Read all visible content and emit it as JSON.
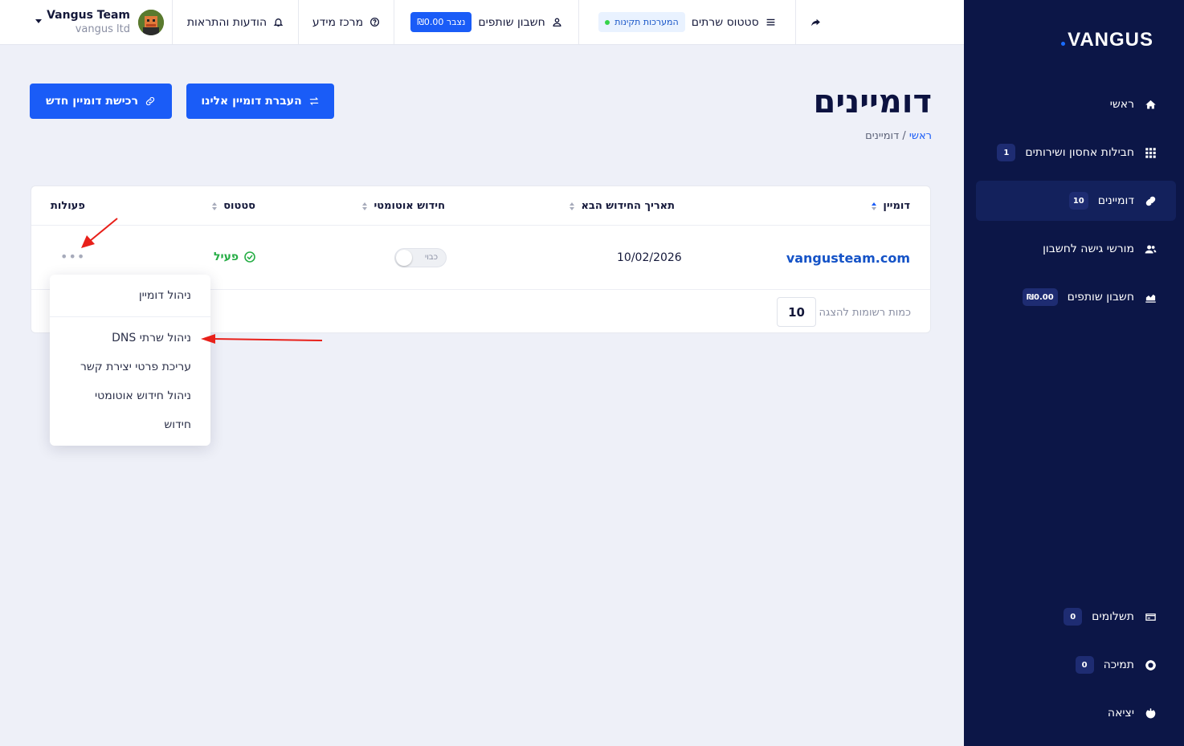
{
  "brand": {
    "logo_text": "VANGUS"
  },
  "sidebar": {
    "items": [
      {
        "label": "ראשי",
        "icon": "home-icon"
      },
      {
        "label": "חבילות אחסון ושירותים",
        "icon": "grid-icon",
        "badge": "1"
      },
      {
        "label": "דומיינים",
        "icon": "link-icon",
        "badge": "10",
        "active": true
      },
      {
        "label": "מורשי גישה לחשבון",
        "icon": "users-icon"
      },
      {
        "label": "חשבון שותפים",
        "icon": "chart-icon",
        "badge": "₪0.00"
      }
    ],
    "bottom_items": [
      {
        "label": "תשלומים",
        "icon": "credit-card-icon",
        "badge": "0"
      },
      {
        "label": "תמיכה",
        "icon": "lifebuoy-icon",
        "badge": "0"
      },
      {
        "label": "יציאה",
        "icon": "power-icon"
      }
    ]
  },
  "topbar": {
    "server_status_label": "סטטוס שרתים",
    "server_status_pill": "המערכות תקינות",
    "affiliate_label": "חשבון שותפים",
    "affiliate_balance": "נצבר ₪0.00",
    "knowledge_label": "מרכז מידע",
    "notifications_label": "הודעות והתראות",
    "user_name": "Vangus Team",
    "user_org": "vangus ltd"
  },
  "page": {
    "title": "דומיינים",
    "breadcrumb_home": "ראשי",
    "breadcrumb_sep": "/",
    "breadcrumb_current": "דומיינים",
    "transfer_button": "העברת דומיין אלינו",
    "buy_button": "רכישת דומיין חדש"
  },
  "table": {
    "columns": [
      "דומיין",
      "תאריך החידוש הבא",
      "חידוש אוטומטי",
      "סטטוס",
      "פעולות"
    ],
    "rows": [
      {
        "domain": "vangusteam.com",
        "renewal_date": "10/02/2026",
        "auto_renew_label": "כבוי",
        "auto_renew": false,
        "status": "פעיל"
      }
    ],
    "per_page_label": "כמות רשומות להצגה",
    "per_page_value": "10",
    "actions_label": "•••"
  },
  "dropdown": {
    "items": [
      "ניהול דומיין",
      "ניהול שרתי DNS",
      "עריכת פרטי יצירת קשר",
      "ניהול חידוש אוטומטי",
      "חידוש"
    ]
  },
  "colors": {
    "sidebar_bg": "#0c1647",
    "accent": "#1a5cf7",
    "status_ok": "#27ae46",
    "annotation_arrow": "#e8201a"
  }
}
